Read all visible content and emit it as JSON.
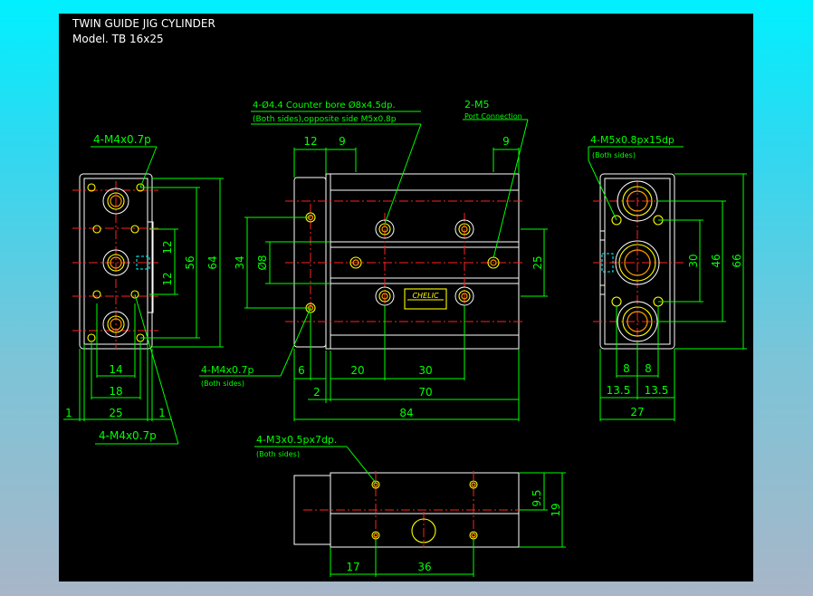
{
  "title": {
    "line1": "TWIN GUIDE JIG CYLINDER",
    "line2": "Model. TB 16x25"
  },
  "notes": {
    "left_top_thread": "4-M4x0.7p",
    "left_bottom_thread": "4-M4x0.7p",
    "counterbore_line1": "4-Ø4.4 Counter bore Ø8x4.5dp.",
    "counterbore_line2": "(Both sides),opposite side M5x0.8p",
    "port_label": "2-M5",
    "port_sub": "Port Connection",
    "front_thread": "4-M4x0.7p",
    "front_thread_sub": "(Both sides)",
    "right_thread": "4-M5x0.8px15dp",
    "right_thread_sub": "(Both sides)",
    "bottom_thread": "4-M3x0.5px7dp.",
    "bottom_thread_sub": "(Both sides)",
    "plate_brand": "CHELIC"
  },
  "dimensions": {
    "left_12a": "12",
    "left_12b": "12",
    "left_56": "56",
    "left_64": "64",
    "left_14": "14",
    "left_18": "18",
    "left_25": "25",
    "left_1a": "1",
    "left_1b": "1",
    "front_12": "12",
    "front_9a": "9",
    "front_9b": "9",
    "front_34": "34",
    "front_d8": "Ø8",
    "front_25": "25",
    "front_6": "6",
    "front_20": "20",
    "front_30": "30",
    "front_2": "2",
    "front_70": "70",
    "front_84": "84",
    "right_30": "30",
    "right_46": "46",
    "right_66": "66",
    "right_8a": "8",
    "right_8b": "8",
    "right_13_5a": "13.5",
    "right_13_5b": "13.5",
    "right_27": "27",
    "bottom_9_5": "9.5",
    "bottom_19": "19",
    "bottom_17": "17",
    "bottom_36": "36"
  },
  "colors": {
    "sheet": "#000000",
    "dimension": "#00ff00",
    "outline": "#ffffff",
    "holes": "#ffff00",
    "centerline": "#ff2020",
    "hidden": "#00ffff"
  }
}
